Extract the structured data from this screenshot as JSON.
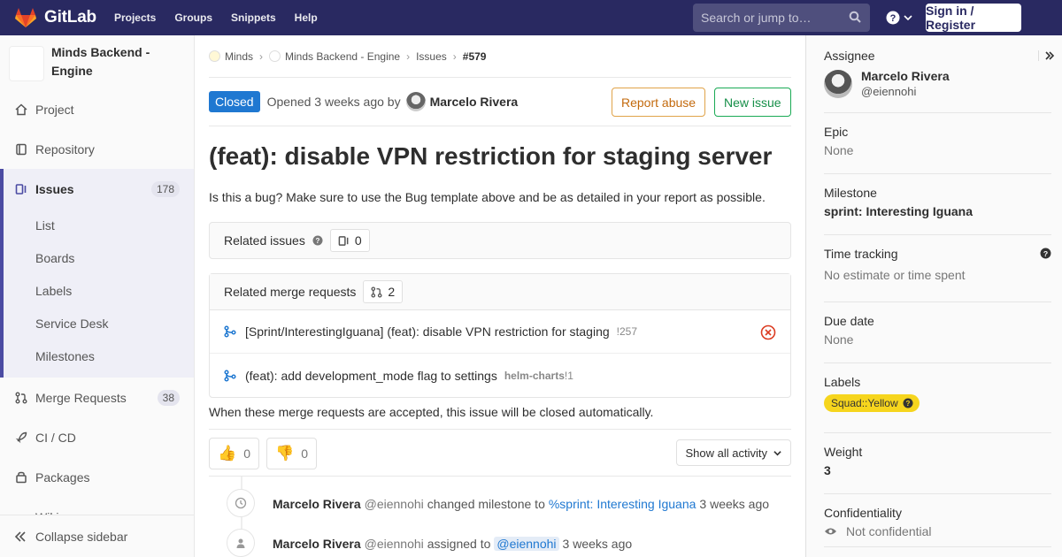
{
  "topbar": {
    "brand": "GitLab",
    "nav": [
      "Projects",
      "Groups",
      "Snippets",
      "Help"
    ],
    "search_placeholder": "Search or jump to…",
    "signin_label": "Sign in / Register"
  },
  "sidebar": {
    "project_name": "Minds Backend - Engine",
    "items": [
      {
        "label": "Project",
        "icon": "home-icon"
      },
      {
        "label": "Repository",
        "icon": "book-icon"
      },
      {
        "label": "Issues",
        "icon": "issues-icon",
        "count": "178",
        "active": true
      },
      {
        "label": "Merge Requests",
        "icon": "merge-request-icon",
        "count": "38"
      },
      {
        "label": "CI / CD",
        "icon": "rocket-icon"
      },
      {
        "label": "Packages",
        "icon": "package-icon"
      },
      {
        "label": "Wiki",
        "icon": "wiki-icon"
      }
    ],
    "issue_subitems": [
      "List",
      "Boards",
      "Labels",
      "Service Desk",
      "Milestones"
    ],
    "collapse_label": "Collapse sidebar"
  },
  "breadcrumb": [
    "Minds",
    "Minds Backend - Engine",
    "Issues",
    "#579"
  ],
  "issue": {
    "status": "Closed",
    "opened_text": "Opened 3 weeks ago by",
    "author": "Marcelo Rivera",
    "report_abuse": "Report abuse",
    "new_issue": "New issue",
    "title": "(feat): disable VPN restriction for staging server",
    "description": "Is this a bug? Make sure to use the Bug template above and be as detailed in your report as possible."
  },
  "related_issues": {
    "label": "Related issues",
    "count": "0"
  },
  "related_mrs": {
    "label": "Related merge requests",
    "count": "2",
    "items": [
      {
        "title": "[Sprint/InterestingIguana] (feat): disable VPN restriction for staging",
        "ref_prefix": "",
        "ref": "!257",
        "status": "closed"
      },
      {
        "title": "(feat): add development_mode flag to settings",
        "ref_prefix": "helm-charts",
        "ref": "!1",
        "status": ""
      }
    ],
    "note": "When these merge requests are accepted, this issue will be closed automatically."
  },
  "awards": {
    "thumbs_up": "0",
    "thumbs_down": "0",
    "show_activity": "Show all activity"
  },
  "notes": [
    {
      "name": "Marcelo Rivera",
      "user": "@eiennohi",
      "action": "changed milestone to",
      "target": "%sprint: Interesting Iguana",
      "time": "3 weeks ago",
      "icon": "clock-icon"
    },
    {
      "name": "Marcelo Rivera",
      "user": "@eiennohi",
      "action": "assigned to",
      "target": "@eiennohi",
      "time": "3 weeks ago",
      "icon": "user-icon"
    }
  ],
  "right": {
    "assignee_label": "Assignee",
    "assignee_name": "Marcelo Rivera",
    "assignee_user": "@eiennohi",
    "epic_label": "Epic",
    "epic_value": "None",
    "milestone_label": "Milestone",
    "milestone_value": "sprint: Interesting Iguana",
    "time_label": "Time tracking",
    "time_value": "No estimate or time spent",
    "due_label": "Due date",
    "due_value": "None",
    "labels_label": "Labels",
    "label_chip": "Squad::Yellow",
    "label_color": "#f6d51d",
    "weight_label": "Weight",
    "weight_value": "3",
    "conf_label": "Confidentiality",
    "conf_value": "Not confidential"
  }
}
